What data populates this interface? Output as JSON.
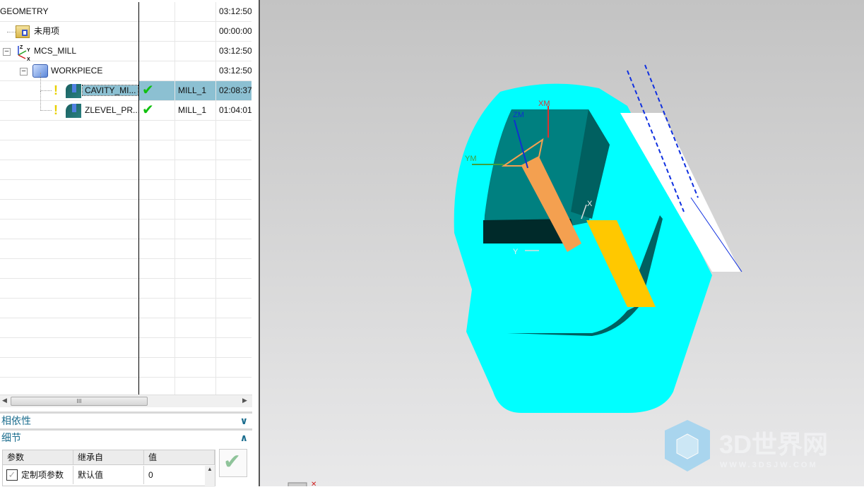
{
  "tree": {
    "rows": [
      {
        "name": "GEOMETRY",
        "tool": "",
        "time": "03:12:50"
      },
      {
        "name": "未用项",
        "tool": "",
        "time": "00:00:00"
      },
      {
        "name": "MCS_MILL",
        "tool": "",
        "time": "03:12:50"
      },
      {
        "name": "WORKPIECE",
        "tool": "",
        "time": "03:12:50"
      },
      {
        "name": "CAVITY_MI...",
        "tool": "MILL_1",
        "time": "02:08:37"
      },
      {
        "name": "ZLEVEL_PR...",
        "tool": "MILL_1",
        "time": "01:04:01"
      }
    ],
    "mcs_axis_labels": {
      "z": "Z",
      "y": "Y",
      "x": "X"
    },
    "scroll_thumb": "III"
  },
  "sections": {
    "dependencies": "相依性",
    "details": "细节"
  },
  "details_table": {
    "headers": [
      "参数",
      "继承自",
      "值"
    ],
    "rows": [
      {
        "param": "定制项参数",
        "inherit": "默认值",
        "value": "0"
      }
    ]
  },
  "viewport": {
    "axis_labels": {
      "xm": "XM",
      "ym": "YM",
      "zm": "ZM",
      "x": "X",
      "y": "Y"
    },
    "watermark": {
      "title": "3D世界网",
      "url": "WWW.3DSJW.COM"
    }
  },
  "colors": {
    "selection": "#8cc0d2",
    "accent": "#1b6d8e",
    "cyan": "#00ffff",
    "teal": "#008080",
    "orange": "#f4a050",
    "yellow": "#ffc800"
  }
}
